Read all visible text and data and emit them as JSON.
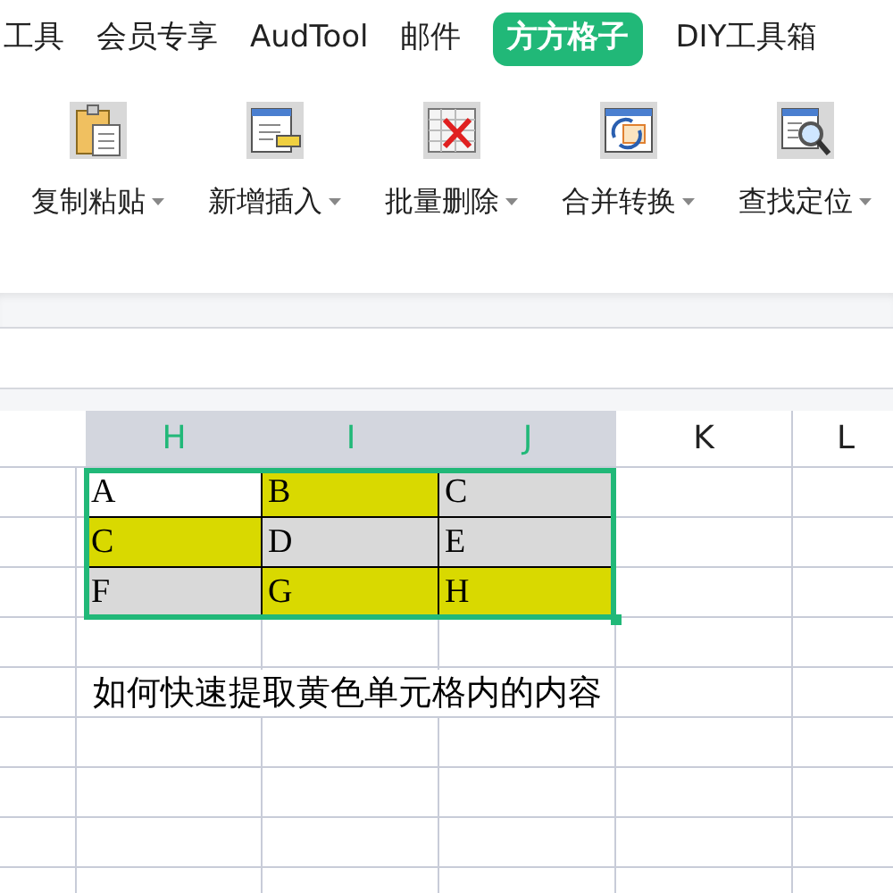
{
  "tabs": [
    {
      "label": "工具",
      "selected": false
    },
    {
      "label": "会员专享",
      "selected": false
    },
    {
      "label": "AudTool",
      "selected": false
    },
    {
      "label": "邮件",
      "selected": false
    },
    {
      "label": "方方格子",
      "selected": true
    },
    {
      "label": "DIY工具箱",
      "selected": false
    }
  ],
  "tools": [
    {
      "label": "复制粘贴",
      "kind": "paste"
    },
    {
      "label": "新增插入",
      "kind": "insert"
    },
    {
      "label": "批量删除",
      "kind": "delete"
    },
    {
      "label": "合并转换",
      "kind": "convert"
    },
    {
      "label": "查找定位",
      "kind": "find"
    }
  ],
  "columns": [
    {
      "label": "H",
      "selected": true
    },
    {
      "label": "I",
      "selected": true
    },
    {
      "label": "J",
      "selected": true
    },
    {
      "label": "K",
      "selected": false
    },
    {
      "label": "L",
      "selected": false
    }
  ],
  "cells": [
    [
      {
        "text": "A",
        "color": "#ffffff"
      },
      {
        "text": "B",
        "color": "#d9d900"
      },
      {
        "text": "C",
        "color": "#d9d9d9"
      }
    ],
    [
      {
        "text": "C",
        "color": "#d9d900"
      },
      {
        "text": "D",
        "color": "#d9d9d9"
      },
      {
        "text": "E",
        "color": "#d9d9d9"
      }
    ],
    [
      {
        "text": "F",
        "color": "#d9d9d9"
      },
      {
        "text": "G",
        "color": "#d9d900"
      },
      {
        "text": "H",
        "color": "#d9d900"
      }
    ]
  ],
  "note": "如何快速提取黄色单元格内的内容"
}
